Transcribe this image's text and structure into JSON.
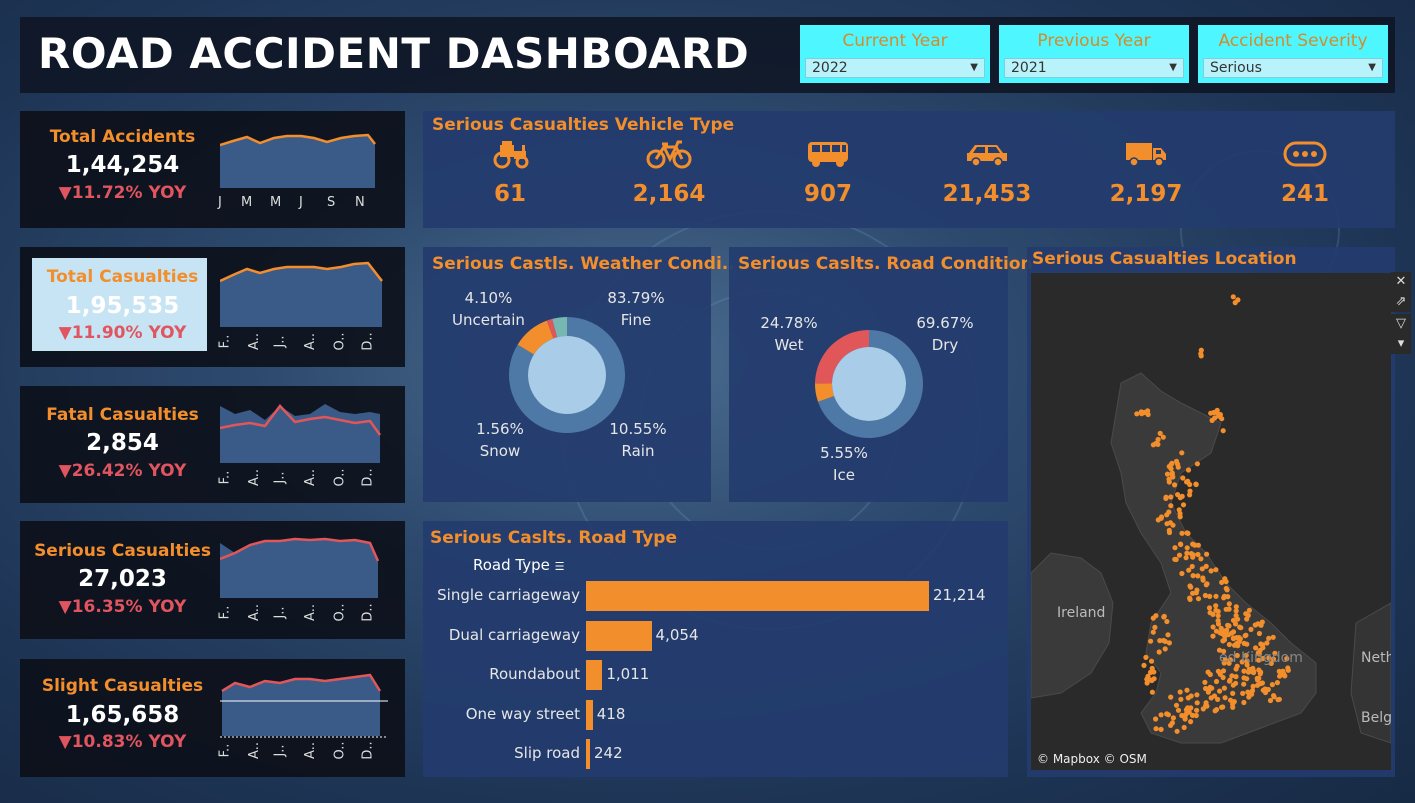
{
  "header": {
    "title": "ROAD ACCIDENT DASHBOARD"
  },
  "filters": [
    {
      "label": "Current Year",
      "value": "2022"
    },
    {
      "label": "Previous Year",
      "value": "2021"
    },
    {
      "label": "Accident Severity",
      "value": "Serious"
    }
  ],
  "kpis": [
    {
      "title": "Total Accidents",
      "value": "1,44,254",
      "yoy": "▼11.72% YOY",
      "ticks": [
        "J",
        "M",
        "M",
        "J",
        "S",
        "N"
      ]
    },
    {
      "title": "Total Casualties",
      "value": "1,95,535",
      "yoy": "▼11.90% YOY",
      "ticks": [
        "F..",
        "A..",
        "J..",
        "A..",
        "O..",
        "D.."
      ]
    },
    {
      "title": "Fatal Casualties",
      "value": "2,854",
      "yoy": "▼26.42% YOY",
      "ticks": [
        "F..",
        "A..",
        "J..",
        "A..",
        "O..",
        "D.."
      ]
    },
    {
      "title": "Serious Casualties",
      "value": "27,023",
      "yoy": "▼16.35% YOY",
      "ticks": [
        "F..",
        "A..",
        "J..",
        "A..",
        "O..",
        "D.."
      ]
    },
    {
      "title": "Slight Casualties",
      "value": "1,65,658",
      "yoy": "▼10.83% YOY",
      "ticks": [
        "F..",
        "A..",
        "J..",
        "A..",
        "O..",
        "D.."
      ]
    }
  ],
  "vehicle": {
    "title": "Serious Casualties Vehicle Type",
    "items": [
      {
        "icon": "tractor-icon",
        "value": "61"
      },
      {
        "icon": "bicycle-icon",
        "value": "2,164"
      },
      {
        "icon": "bus-icon",
        "value": "907"
      },
      {
        "icon": "car-icon",
        "value": "21,453"
      },
      {
        "icon": "truck-icon",
        "value": "2,197"
      },
      {
        "icon": "more-icon",
        "value": "241"
      }
    ]
  },
  "weather": {
    "title": "Serious Castls. Weather Condi..",
    "labels": {
      "uncertain_pct": "4.10%",
      "uncertain": "Uncertain",
      "fine_pct": "83.79%",
      "fine": "Fine",
      "snow_pct": "1.56%",
      "snow": "Snow",
      "rain_pct": "10.55%",
      "rain": "Rain"
    }
  },
  "roadcond": {
    "title": "Serious Caslts. Road Condition",
    "labels": {
      "wet_pct": "24.78%",
      "wet": "Wet",
      "dry_pct": "69.67%",
      "dry": "Dry",
      "ice_pct": "5.55%",
      "ice": "Ice"
    }
  },
  "roadtype": {
    "title": "Serious Caslts. Road Type",
    "header": "Road Type",
    "rows": [
      {
        "label": "Single carriageway",
        "value": "21,214"
      },
      {
        "label": "Dual carriageway",
        "value": "4,054"
      },
      {
        "label": "Roundabout",
        "value": "1,011"
      },
      {
        "label": "One way street",
        "value": "418"
      },
      {
        "label": "Slip road",
        "value": "242"
      }
    ]
  },
  "map": {
    "title": "Serious Casualties Location",
    "labels": {
      "ireland": "Ireland",
      "kingdom": "ed Kingdom",
      "neth": "Neth",
      "belg": "Belg"
    },
    "attribution": "© Mapbox © OSM"
  },
  "chart_data": [
    {
      "type": "line",
      "title": "Serious Casualties Vehicle Type",
      "categories": [
        "Tractor",
        "Bicycle",
        "Bus",
        "Car",
        "Truck",
        "Other"
      ],
      "values": [
        61,
        2164,
        907,
        21453,
        2197,
        241
      ]
    },
    {
      "type": "pie",
      "title": "Serious Castls. Weather Condi..",
      "categories": [
        "Fine",
        "Rain",
        "Snow",
        "Uncertain"
      ],
      "values": [
        83.79,
        10.55,
        1.56,
        4.1
      ],
      "colors": [
        "#4e79a7",
        "#f28e2b",
        "#e15759",
        "#76b7b2"
      ]
    },
    {
      "type": "pie",
      "title": "Serious Caslts. Road Condition",
      "categories": [
        "Dry",
        "Ice",
        "Wet"
      ],
      "values": [
        69.67,
        5.55,
        24.78
      ],
      "colors": [
        "#4e79a7",
        "#f28e2b",
        "#e15759"
      ]
    },
    {
      "type": "bar",
      "title": "Serious Caslts. Road Type",
      "categories": [
        "Single carriageway",
        "Dual carriageway",
        "Roundabout",
        "One way street",
        "Slip road"
      ],
      "values": [
        21214,
        4054,
        1011,
        418,
        242
      ]
    }
  ]
}
